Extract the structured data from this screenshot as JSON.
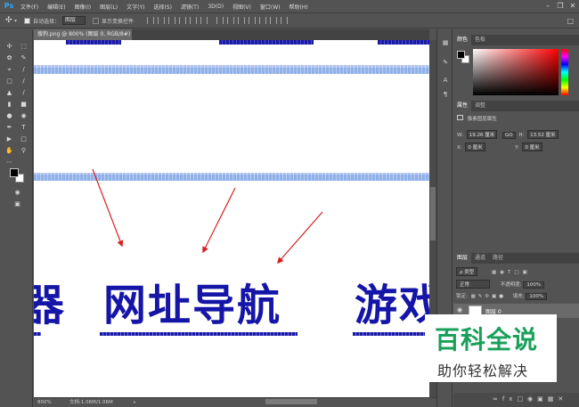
{
  "app": {
    "logo": "Ps",
    "menu": [
      "文件(F)",
      "编辑(E)",
      "图像(I)",
      "图层(L)",
      "文字(Y)",
      "选择(S)",
      "滤镜(T)",
      "3D(D)",
      "视图(V)",
      "窗口(W)",
      "帮助(H)"
    ]
  },
  "options": {
    "auto_select_label": "自动选择：",
    "auto_select_value": "图层",
    "transform_label": "显示变换控件"
  },
  "document": {
    "tab_title": "搜狗.png @ 800% (图层 0, RGB/8#)",
    "close_glyph": "×",
    "words": [
      "网址导航",
      "游戏"
    ],
    "left_fragment": "器"
  },
  "status": {
    "zoom": "800%",
    "doc_info": "文档:1.06M/1.06M"
  },
  "color_panel": {
    "tabs": [
      "颜色",
      "色板"
    ]
  },
  "properties_panel": {
    "tabs": [
      "属性",
      "调整"
    ],
    "header": "像素图层属性",
    "w_label": "W:",
    "w_value": "19.26 厘米",
    "link_icon": "GO",
    "h_label": "H:",
    "h_value": "13.52 厘米",
    "x_label": "X:",
    "x_value": "0 厘米",
    "y_label": "Y:",
    "y_value": "0 厘米"
  },
  "layers_panel": {
    "tabs": [
      "图层",
      "通道",
      "路径"
    ],
    "filter_label": "ρ 类型",
    "blend_mode": "正常",
    "opacity_label": "不透明度:",
    "opacity_value": "100%",
    "lock_label": "锁定:",
    "fill_label": "填充:",
    "fill_value": "100%",
    "layer_name": "图层 0"
  },
  "watermark": {
    "title": "百科全说",
    "subtitle": "助你轻松解决"
  },
  "colors": {
    "ui_gray": "#535353",
    "pixel_blue": "#1515a8",
    "arrow_red": "#d62020",
    "watermark_green": "#1aa05a"
  }
}
